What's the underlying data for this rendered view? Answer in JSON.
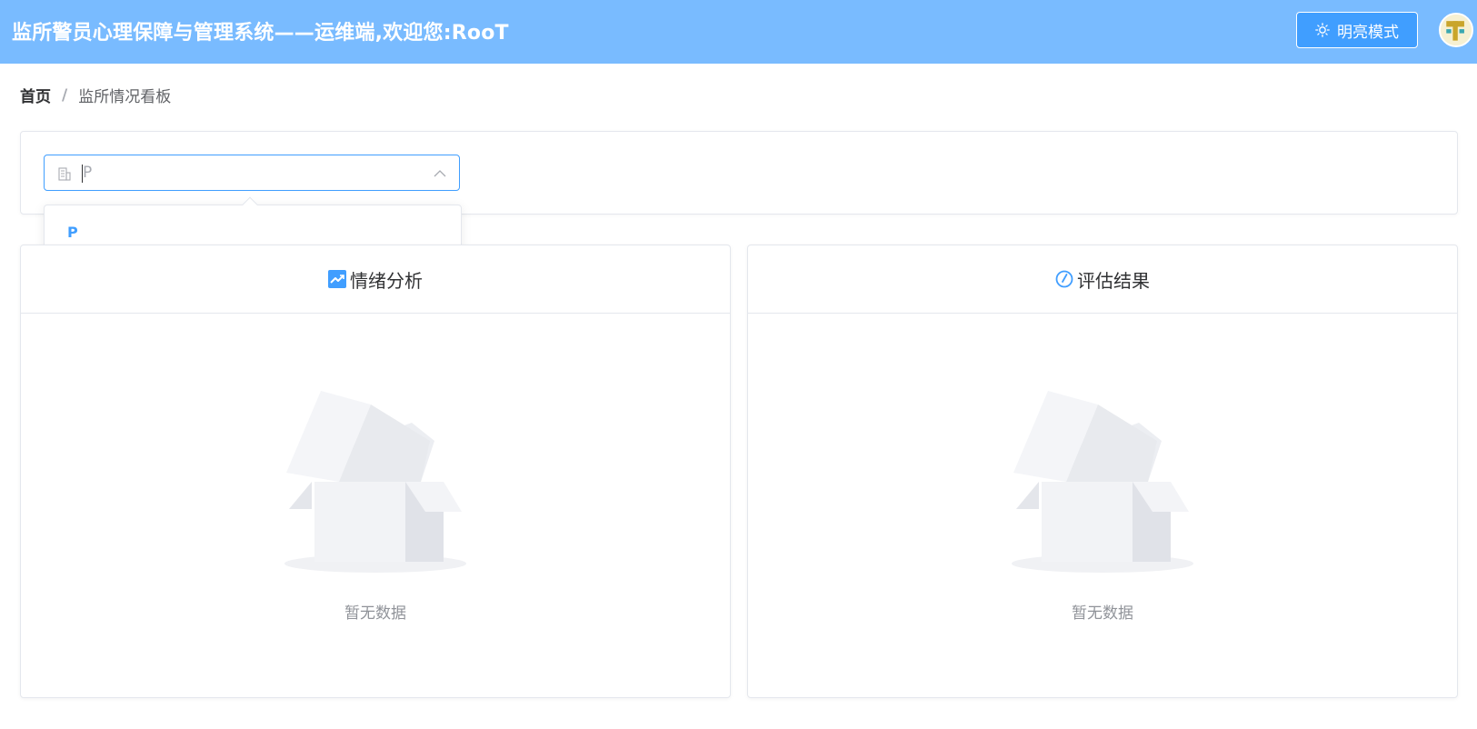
{
  "header": {
    "title": "监所警员心理保障与管理系统——运维端,欢迎您:RooT",
    "theme_button_label": "明亮模式",
    "theme_button_icon": "sun-icon",
    "bg_color": "#79bbff"
  },
  "breadcrumb": {
    "home": "首页",
    "separator": "/",
    "current": "监所情况看板"
  },
  "filter": {
    "select_value": "P",
    "select_icon": "building-icon",
    "dropdown_options": [
      "P"
    ]
  },
  "panels": {
    "emotion": {
      "title": "情绪分析",
      "icon": "trend-chart-icon",
      "empty_text": "暂无数据"
    },
    "assessment": {
      "title": "评估结果",
      "icon": "compass-icon",
      "empty_text": "暂无数据"
    }
  },
  "colors": {
    "accent": "#409eff"
  }
}
